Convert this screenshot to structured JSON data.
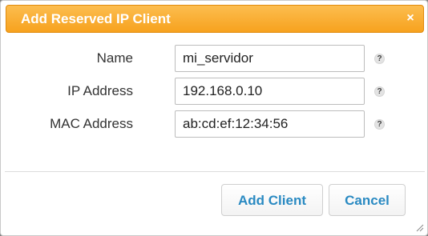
{
  "dialog": {
    "title": "Add Reserved IP Client",
    "close_glyph": "×",
    "close_icon": "close-icon"
  },
  "form": {
    "name": {
      "label": "Name",
      "value": "mi_servidor"
    },
    "ip_address": {
      "label": "IP Address",
      "value": "192.168.0.10"
    },
    "mac_address": {
      "label": "MAC Address",
      "value": "ab:cd:ef:12:34:56"
    },
    "help_glyph": "?",
    "help_icon": "help-icon"
  },
  "buttons": {
    "add_label": "Add Client",
    "cancel_label": "Cancel"
  },
  "colors": {
    "titlebar": "#f7a21e",
    "button_text": "#2a8ac2"
  }
}
